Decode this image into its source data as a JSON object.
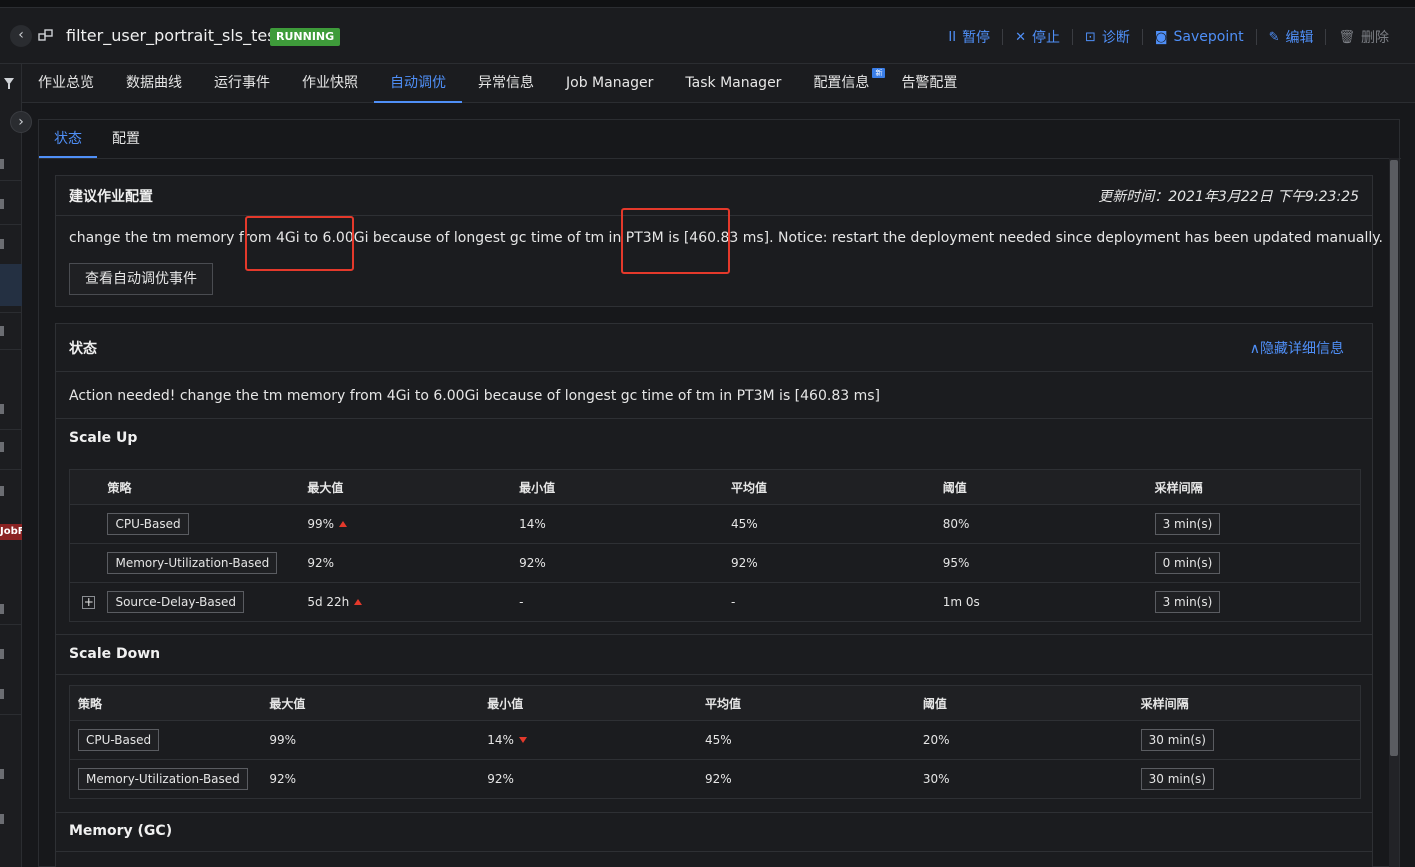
{
  "header": {
    "job_name": "filter_user_portrait_sls_test",
    "status": "RUNNING",
    "actions": [
      {
        "label": "暂停",
        "icon": "pause-icon",
        "glyph": "II"
      },
      {
        "label": "停止",
        "icon": "close-icon",
        "glyph": "✕"
      },
      {
        "label": "诊断",
        "icon": "diagnose-icon",
        "glyph": "⊡"
      },
      {
        "label": "Savepoint",
        "icon": "camera-icon",
        "glyph": "◙"
      },
      {
        "label": "编辑",
        "icon": "edit-icon",
        "glyph": "✎"
      },
      {
        "label": "删除",
        "icon": "trash-icon",
        "glyph": "🗑"
      }
    ]
  },
  "main_tabs": [
    "作业总览",
    "数据曲线",
    "运行事件",
    "作业快照",
    "自动调优",
    "异常信息",
    "Job Manager",
    "Task Manager",
    "配置信息",
    "告警配置"
  ],
  "new_badge": "新",
  "sub_tabs": [
    "状态",
    "配置"
  ],
  "left_rail": {
    "badge": "JobF"
  },
  "suggestion": {
    "title": "建议作业配置",
    "update_time": "更新时间：2021年3月22日 下午9:23:25",
    "text": "change the tm memory from 4Gi to 6.00Gi because of longest gc time of tm in PT3M is [460.83 ms]. Notice: restart the deployment needed since deployment has been updated manually.",
    "button": "查看自动调优事件"
  },
  "status": {
    "title": "状态",
    "hide_link": "∧隐藏详细信息",
    "action_text": "Action needed! change the tm memory from 4Gi to 6.00Gi because of longest gc time of tm in PT3M is [460.83 ms]"
  },
  "columns": [
    "策略",
    "最大值",
    "最小值",
    "平均值",
    "阈值",
    "采样间隔"
  ],
  "scale_up": {
    "title": "Scale Up",
    "rows": [
      {
        "strategy": "CPU-Based",
        "max": "99%",
        "max_up": true,
        "min": "14%",
        "avg": "45%",
        "threshold": "80%",
        "interval": "3 min(s)",
        "expandable": false
      },
      {
        "strategy": "Memory-Utilization-Based",
        "max": "92%",
        "max_up": false,
        "min": "92%",
        "avg": "92%",
        "threshold": "95%",
        "interval": "0 min(s)",
        "expandable": false
      },
      {
        "strategy": "Source-Delay-Based",
        "max": "5d 22h",
        "max_up": true,
        "min": "-",
        "avg": "-",
        "threshold": "1m 0s",
        "interval": "3 min(s)",
        "expandable": true
      }
    ]
  },
  "scale_down": {
    "title": "Scale Down",
    "rows": [
      {
        "strategy": "CPU-Based",
        "max": "99%",
        "min": "14%",
        "min_down": true,
        "avg": "45%",
        "threshold": "20%",
        "interval": "30 min(s)"
      },
      {
        "strategy": "Memory-Utilization-Based",
        "max": "92%",
        "min": "92%",
        "min_down": false,
        "avg": "92%",
        "threshold": "30%",
        "interval": "30 min(s)"
      }
    ]
  },
  "memory_gc": {
    "title": "Memory (GC)"
  },
  "colors": {
    "accent": "#4f8ff7",
    "running": "#3e9b3a",
    "highlight": "#e4392b",
    "bg": "#17181b"
  }
}
